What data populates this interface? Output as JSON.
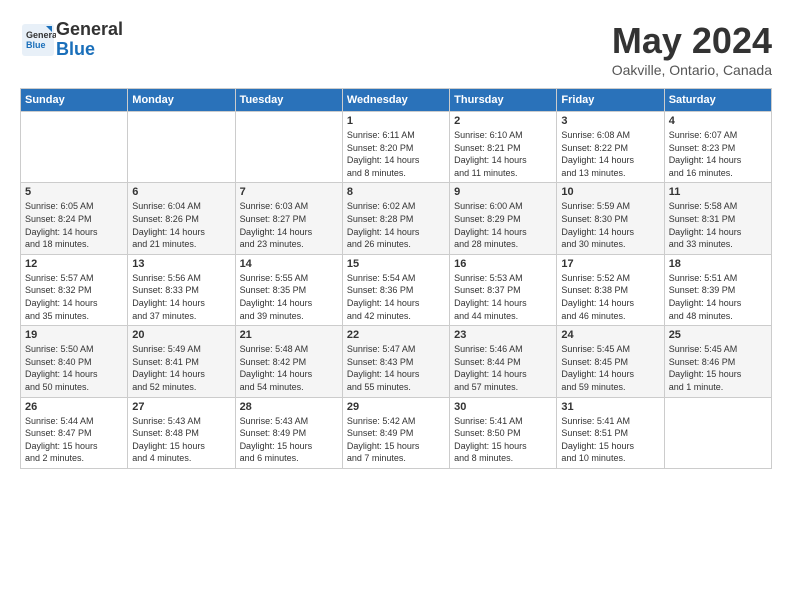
{
  "header": {
    "logo": {
      "general": "General",
      "blue": "Blue"
    },
    "title": "May 2024",
    "location": "Oakville, Ontario, Canada"
  },
  "weekdays": [
    "Sunday",
    "Monday",
    "Tuesday",
    "Wednesday",
    "Thursday",
    "Friday",
    "Saturday"
  ],
  "weeks": [
    [
      {
        "day": "",
        "info": ""
      },
      {
        "day": "",
        "info": ""
      },
      {
        "day": "",
        "info": ""
      },
      {
        "day": "1",
        "info": "Sunrise: 6:11 AM\nSunset: 8:20 PM\nDaylight: 14 hours\nand 8 minutes."
      },
      {
        "day": "2",
        "info": "Sunrise: 6:10 AM\nSunset: 8:21 PM\nDaylight: 14 hours\nand 11 minutes."
      },
      {
        "day": "3",
        "info": "Sunrise: 6:08 AM\nSunset: 8:22 PM\nDaylight: 14 hours\nand 13 minutes."
      },
      {
        "day": "4",
        "info": "Sunrise: 6:07 AM\nSunset: 8:23 PM\nDaylight: 14 hours\nand 16 minutes."
      }
    ],
    [
      {
        "day": "5",
        "info": "Sunrise: 6:05 AM\nSunset: 8:24 PM\nDaylight: 14 hours\nand 18 minutes."
      },
      {
        "day": "6",
        "info": "Sunrise: 6:04 AM\nSunset: 8:26 PM\nDaylight: 14 hours\nand 21 minutes."
      },
      {
        "day": "7",
        "info": "Sunrise: 6:03 AM\nSunset: 8:27 PM\nDaylight: 14 hours\nand 23 minutes."
      },
      {
        "day": "8",
        "info": "Sunrise: 6:02 AM\nSunset: 8:28 PM\nDaylight: 14 hours\nand 26 minutes."
      },
      {
        "day": "9",
        "info": "Sunrise: 6:00 AM\nSunset: 8:29 PM\nDaylight: 14 hours\nand 28 minutes."
      },
      {
        "day": "10",
        "info": "Sunrise: 5:59 AM\nSunset: 8:30 PM\nDaylight: 14 hours\nand 30 minutes."
      },
      {
        "day": "11",
        "info": "Sunrise: 5:58 AM\nSunset: 8:31 PM\nDaylight: 14 hours\nand 33 minutes."
      }
    ],
    [
      {
        "day": "12",
        "info": "Sunrise: 5:57 AM\nSunset: 8:32 PM\nDaylight: 14 hours\nand 35 minutes."
      },
      {
        "day": "13",
        "info": "Sunrise: 5:56 AM\nSunset: 8:33 PM\nDaylight: 14 hours\nand 37 minutes."
      },
      {
        "day": "14",
        "info": "Sunrise: 5:55 AM\nSunset: 8:35 PM\nDaylight: 14 hours\nand 39 minutes."
      },
      {
        "day": "15",
        "info": "Sunrise: 5:54 AM\nSunset: 8:36 PM\nDaylight: 14 hours\nand 42 minutes."
      },
      {
        "day": "16",
        "info": "Sunrise: 5:53 AM\nSunset: 8:37 PM\nDaylight: 14 hours\nand 44 minutes."
      },
      {
        "day": "17",
        "info": "Sunrise: 5:52 AM\nSunset: 8:38 PM\nDaylight: 14 hours\nand 46 minutes."
      },
      {
        "day": "18",
        "info": "Sunrise: 5:51 AM\nSunset: 8:39 PM\nDaylight: 14 hours\nand 48 minutes."
      }
    ],
    [
      {
        "day": "19",
        "info": "Sunrise: 5:50 AM\nSunset: 8:40 PM\nDaylight: 14 hours\nand 50 minutes."
      },
      {
        "day": "20",
        "info": "Sunrise: 5:49 AM\nSunset: 8:41 PM\nDaylight: 14 hours\nand 52 minutes."
      },
      {
        "day": "21",
        "info": "Sunrise: 5:48 AM\nSunset: 8:42 PM\nDaylight: 14 hours\nand 54 minutes."
      },
      {
        "day": "22",
        "info": "Sunrise: 5:47 AM\nSunset: 8:43 PM\nDaylight: 14 hours\nand 55 minutes."
      },
      {
        "day": "23",
        "info": "Sunrise: 5:46 AM\nSunset: 8:44 PM\nDaylight: 14 hours\nand 57 minutes."
      },
      {
        "day": "24",
        "info": "Sunrise: 5:45 AM\nSunset: 8:45 PM\nDaylight: 14 hours\nand 59 minutes."
      },
      {
        "day": "25",
        "info": "Sunrise: 5:45 AM\nSunset: 8:46 PM\nDaylight: 15 hours\nand 1 minute."
      }
    ],
    [
      {
        "day": "26",
        "info": "Sunrise: 5:44 AM\nSunset: 8:47 PM\nDaylight: 15 hours\nand 2 minutes."
      },
      {
        "day": "27",
        "info": "Sunrise: 5:43 AM\nSunset: 8:48 PM\nDaylight: 15 hours\nand 4 minutes."
      },
      {
        "day": "28",
        "info": "Sunrise: 5:43 AM\nSunset: 8:49 PM\nDaylight: 15 hours\nand 6 minutes."
      },
      {
        "day": "29",
        "info": "Sunrise: 5:42 AM\nSunset: 8:49 PM\nDaylight: 15 hours\nand 7 minutes."
      },
      {
        "day": "30",
        "info": "Sunrise: 5:41 AM\nSunset: 8:50 PM\nDaylight: 15 hours\nand 8 minutes."
      },
      {
        "day": "31",
        "info": "Sunrise: 5:41 AM\nSunset: 8:51 PM\nDaylight: 15 hours\nand 10 minutes."
      },
      {
        "day": "",
        "info": ""
      }
    ]
  ]
}
